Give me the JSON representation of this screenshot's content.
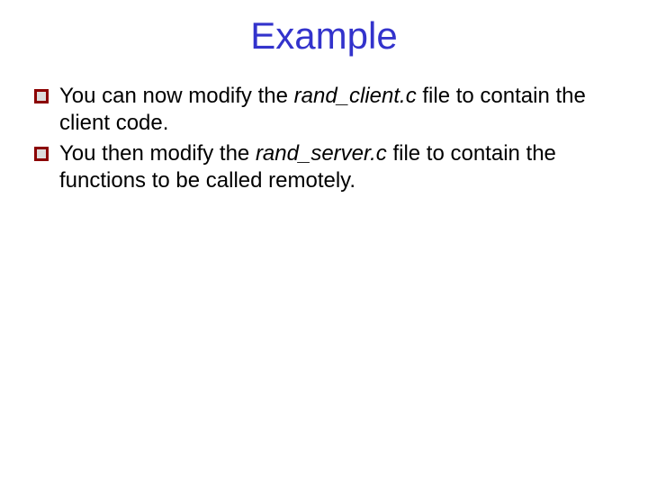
{
  "slide": {
    "title": "Example",
    "bullets": [
      {
        "pre": "You can now modify the ",
        "file": "rand_client.c",
        "post": " file to contain the client code."
      },
      {
        "pre": "You then modify the ",
        "file": "rand_server.c",
        "post": " file to contain the functions to be called remotely."
      }
    ]
  }
}
